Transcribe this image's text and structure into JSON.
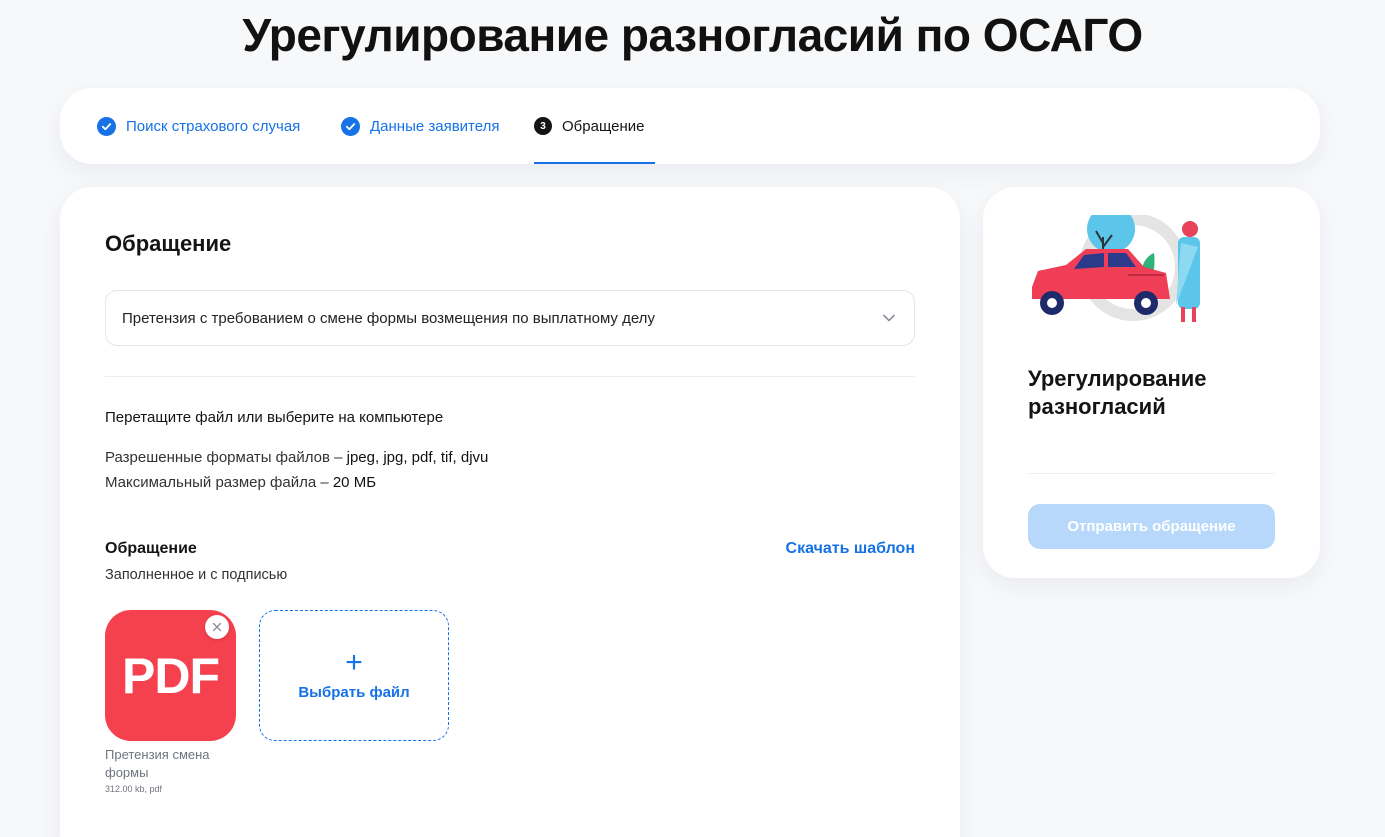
{
  "page": {
    "title": "Урегулирование разногласий по ОСАГО"
  },
  "stepper": {
    "steps": [
      {
        "label": "Поиск страхового случая",
        "state": "done"
      },
      {
        "label": "Данные заявителя",
        "state": "done"
      },
      {
        "label": "Обращение",
        "state": "active",
        "number": "3"
      }
    ]
  },
  "form": {
    "title": "Обращение",
    "request_type": {
      "value": "Претензия с требованием о смене формы возмещения по выплатному делу"
    },
    "upload_hint": "Перетащите файл или выберите на компьютере",
    "formats_label": "Разрешенные форматы файлов – ",
    "formats_value": "jpeg, jpg, pdf, tif, djvu",
    "max_size_label": "Максимальный размер файла – ",
    "max_size_value": "20 МБ",
    "document": {
      "title": "Обращение",
      "subtitle": "Заполненное и с подписью",
      "download_link": "Скачать шаблон"
    },
    "file": {
      "type_label": "PDF",
      "name": "Претензия смена формы",
      "meta": "312.00 kb, pdf"
    },
    "choose_file": {
      "plus": "+",
      "label": "Выбрать файл"
    }
  },
  "sidebar": {
    "title": "Урегулирование разногласий",
    "submit_label": "Отправить обращение",
    "submit_enabled": false
  },
  "colors": {
    "accent": "#1672e6",
    "pdf_red": "#f5404e",
    "disabled_button": "#b7d8fb"
  }
}
